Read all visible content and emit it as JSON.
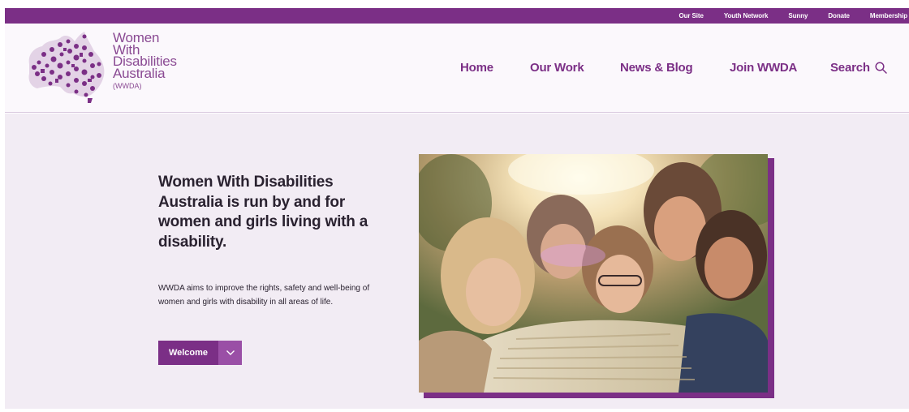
{
  "topbar": {
    "links": [
      "Our Site",
      "Youth Network",
      "Sunny",
      "Donate",
      "Membership"
    ]
  },
  "logo": {
    "lines": [
      "Women",
      "With",
      "Disabilities",
      "Australia"
    ],
    "abbr": "(WWDA)",
    "icon": "australia-map-icon"
  },
  "nav": {
    "home": "Home",
    "work": "Our Work",
    "news": "News & Blog",
    "join": "Join WWDA",
    "search": "Search",
    "search_icon": "search-icon"
  },
  "hero": {
    "heading": "Women With Disabilities Australia is run by and for women and girls living with a disability.",
    "body": "WWDA aims to improve the rights, safety and well-being of women and girls with disability in all areas of life.",
    "button_label": "Welcome",
    "button_icon": "chevron-down-icon",
    "photo": "group-of-smiling-women-hugging-photo"
  },
  "colors": {
    "brand": "#7b2f86",
    "hero_bg": "#f2ecf4"
  }
}
